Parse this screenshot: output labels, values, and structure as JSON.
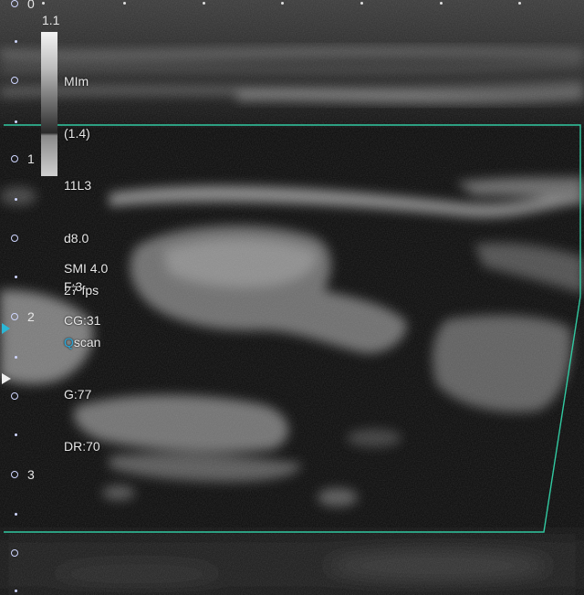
{
  "grayscale_bar": {
    "max_label": "1.1"
  },
  "parameters": [
    "MIm",
    "(1.4)",
    "11L3",
    "d8.0",
    "27 fps",
    "scan",
    "G:77",
    "DR:70"
  ],
  "scan_mode_prefix": "Q",
  "smi": {
    "label": "SMI 4.0",
    "color_gain": "CG:31"
  },
  "focus": "F:3",
  "depth_scale": [
    "0",
    "1",
    "2",
    "3"
  ],
  "colors": {
    "roi_box": "#31c9a1",
    "focus_marker": "#2ab7d6",
    "depth_marker": "#cfd6ff",
    "q_letter": "#29a8d9"
  }
}
